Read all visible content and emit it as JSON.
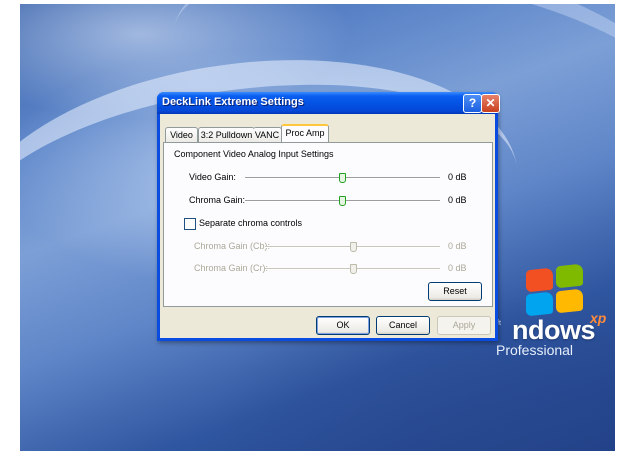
{
  "desktop": {
    "logo_prefix": "ft",
    "logo_text": "ndows",
    "logo_superscript": "xp",
    "logo_edition": "Professional"
  },
  "window": {
    "title": "DeckLink Extreme Settings",
    "help_glyph": "?",
    "close_glyph": "✕",
    "tabs": [
      "Video",
      "3:2 Pulldown",
      "VANC",
      "Proc Amp"
    ],
    "active_tab": "Proc Amp"
  },
  "proc_amp": {
    "group_label": "Component Video Analog Input Settings",
    "video_gain": {
      "label": "Video Gain:",
      "value": "0 dB",
      "level": 0.5
    },
    "chroma_gain": {
      "label": "Chroma Gain:",
      "value": "0 dB",
      "level": 0.5
    },
    "separate_chroma": {
      "label": "Separate chroma controls",
      "checked": false
    },
    "chroma_cb": {
      "label": "Chroma Gain (Cb):",
      "value": "0 dB",
      "level": 0.5,
      "enabled": false
    },
    "chroma_cr": {
      "label": "Chroma Gain (Cr):",
      "value": "0 dB",
      "level": 0.5,
      "enabled": false
    },
    "reset_label": "Reset"
  },
  "buttons": {
    "ok": "OK",
    "cancel": "Cancel",
    "apply": "Apply"
  }
}
